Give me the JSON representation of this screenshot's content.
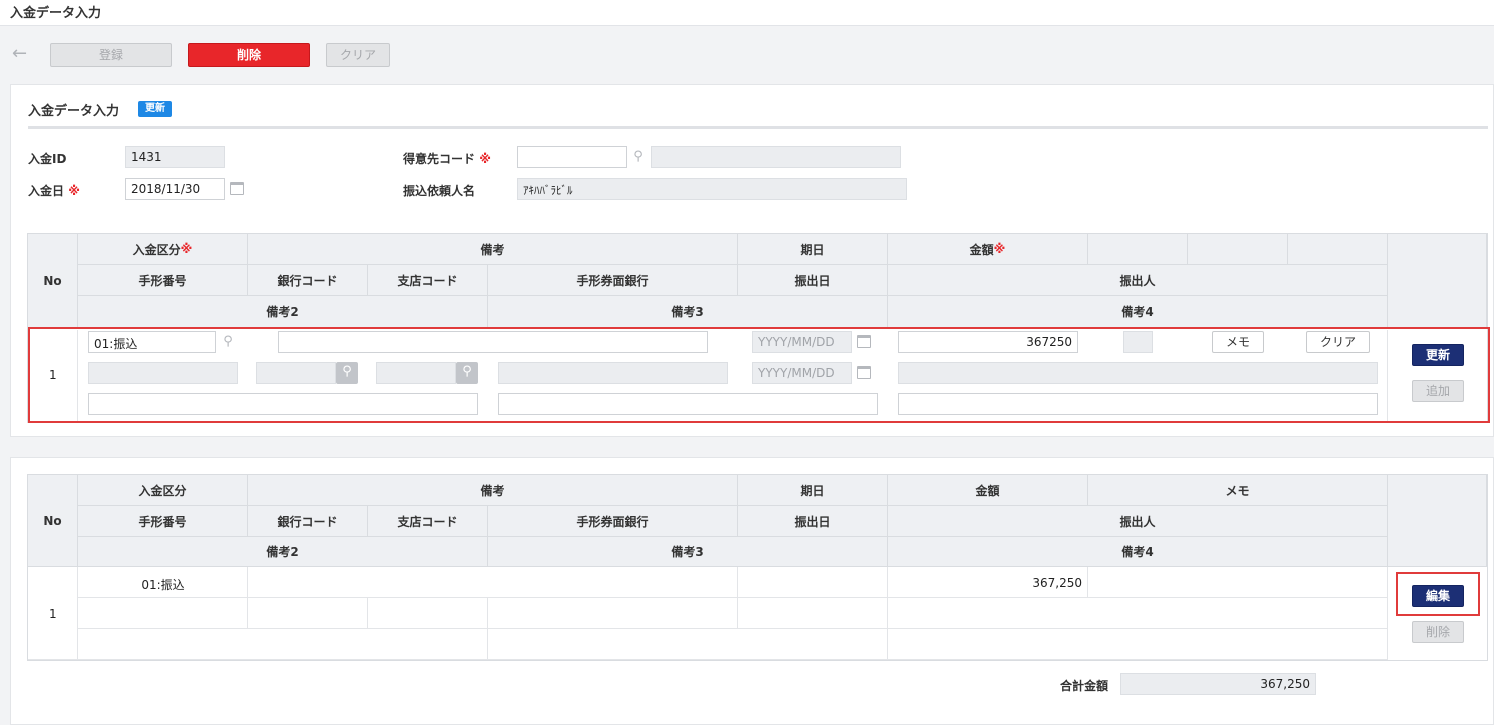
{
  "window": {
    "title": "入金データ入力"
  },
  "toolbar": {
    "register": "登録",
    "delete": "削除",
    "clear": "クリア"
  },
  "form": {
    "title": "入金データ入力",
    "badge": "更新",
    "required_mark": "※",
    "payment_id": {
      "label": "入金ID",
      "value": "1431"
    },
    "payment_date": {
      "label": "入金日",
      "value": "2018/11/30"
    },
    "customer_code": {
      "label": "得意先コード",
      "value": "",
      "name": ""
    },
    "requester_name": {
      "label": "振込依頼人名",
      "value": "ｱｷﾊﾊﾞﾗﾋﾞﾙ"
    }
  },
  "headers": {
    "no": "No",
    "payment_type": "入金区分",
    "remarks": "備考",
    "due_date": "期日",
    "amount": "金額",
    "memo": "メモ",
    "bill_number": "手形番号",
    "bank_code": "銀行コード",
    "branch_code": "支店コード",
    "bill_bank": "手形券面銀行",
    "issue_date": "振出日",
    "drawer": "振出人",
    "remarks2": "備考2",
    "remarks3": "備考3",
    "remarks4": "備考4"
  },
  "entry": {
    "no": "1",
    "payment_type": "01:振込",
    "date_placeholder": "YYYY/MM/DD",
    "amount": "367250",
    "memo_button": "メモ",
    "clear_button": "クリア",
    "update_button": "更新",
    "add_button": "追加"
  },
  "list": {
    "rows": [
      {
        "no": "1",
        "payment_type": "01:振込",
        "amount": "367,250",
        "memo": ""
      }
    ],
    "edit_button": "編集",
    "delete_button": "削除",
    "total_label": "合計金額",
    "total_value": "367,250"
  },
  "colors": {
    "accent_red": "#e8262a",
    "navy": "#1c2f75",
    "badge_blue": "#1e88e5"
  }
}
